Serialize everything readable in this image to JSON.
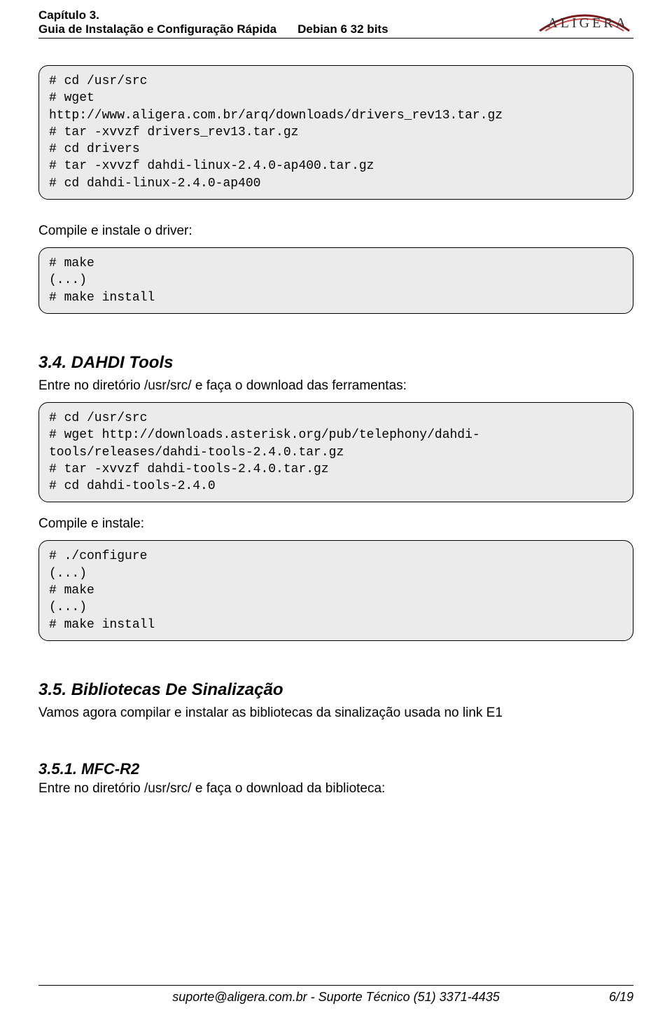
{
  "header": {
    "chapter": "Capítulo 3.",
    "doc_title": "Guia de Instalação e Configuração Rápida",
    "doc_subtitle": "Debian 6 32 bits",
    "brand_text": "ALIGERA"
  },
  "code_block_1": "# cd /usr/src\n# wget\nhttp://www.aligera.com.br/arq/downloads/drivers_rev13.tar.gz\n# tar -xvvzf drivers_rev13.tar.gz\n# cd drivers\n# tar -xvvzf dahdi-linux-2.4.0-ap400.tar.gz\n# cd dahdi-linux-2.4.0-ap400",
  "para_1": "Compile e instale o driver:",
  "code_block_2": "# make\n(...)\n# make install",
  "section_34": "3.4. DAHDI Tools",
  "para_2": "Entre no diretório /usr/src/ e faça o download das ferramentas:",
  "code_block_3": "# cd /usr/src\n# wget http://downloads.asterisk.org/pub/telephony/dahdi-tools/releases/dahdi-tools-2.4.0.tar.gz\n# tar -xvvzf dahdi-tools-2.4.0.tar.gz\n# cd dahdi-tools-2.4.0",
  "para_3": "Compile e instale:",
  "code_block_4": "# ./configure\n(...)\n# make\n(...)\n# make install",
  "section_35": "3.5. Bibliotecas De Sinalização",
  "para_4": "Vamos agora compilar e instalar as bibliotecas da sinalização usada no link E1",
  "subsection_351": "3.5.1. MFC-R2",
  "para_5": "Entre no diretório /usr/src/ e faça o download da biblioteca:",
  "footer": {
    "text": "suporte@aligera.com.br - Suporte Técnico (51) 3371-4435",
    "pageno": "6/19"
  }
}
